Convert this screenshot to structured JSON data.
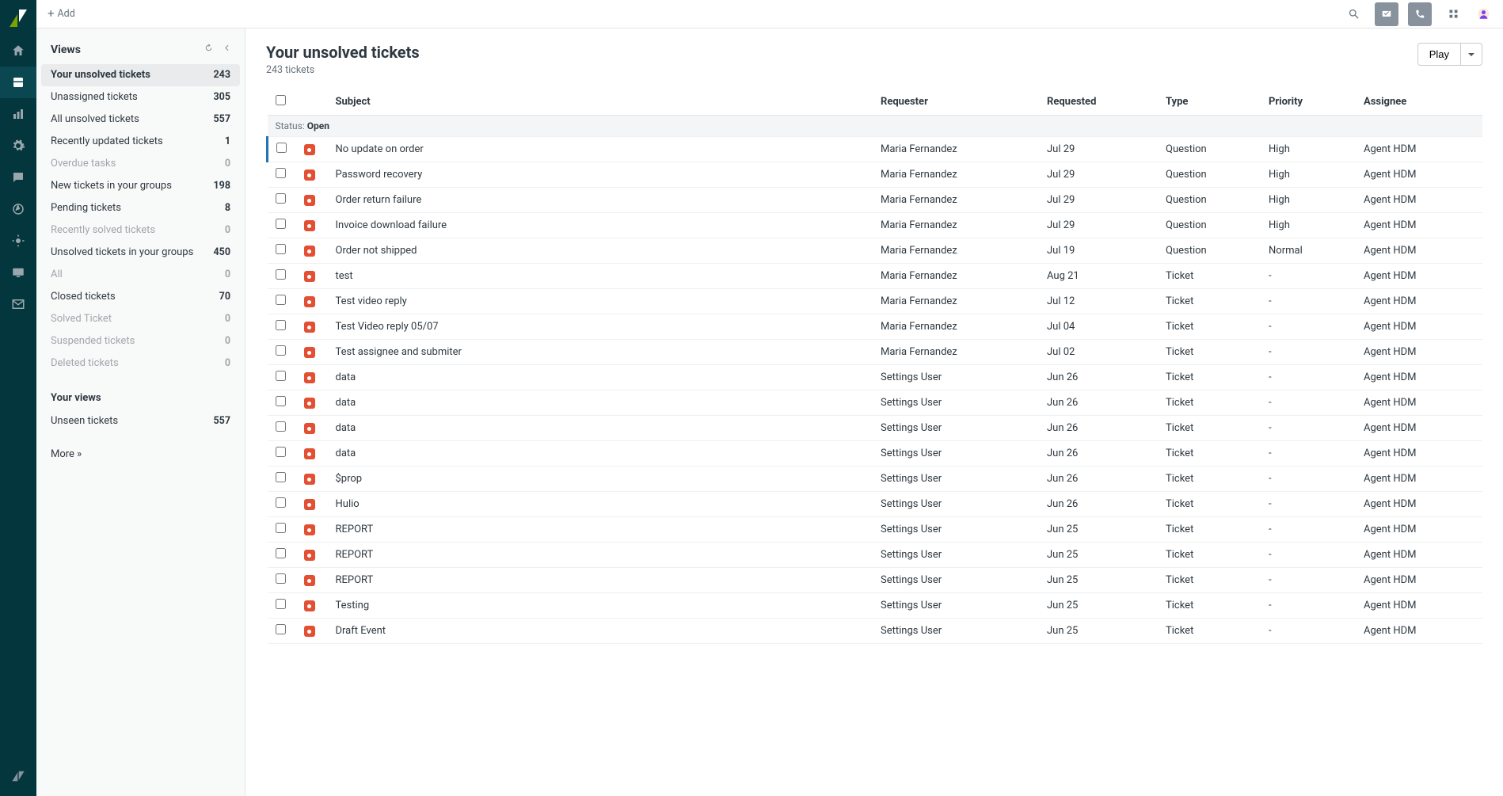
{
  "add_label": "Add",
  "rail": [
    {
      "name": "home-icon"
    },
    {
      "name": "views-icon",
      "active": true
    },
    {
      "name": "reporting-icon"
    },
    {
      "name": "admin-icon"
    },
    {
      "name": "chat-icon"
    },
    {
      "name": "explore-icon"
    },
    {
      "name": "sun-icon"
    },
    {
      "name": "desktop-icon"
    },
    {
      "name": "mail-icon"
    }
  ],
  "sidebar": {
    "heading": "Views",
    "section2": "Your views",
    "items": [
      {
        "label": "Your unsolved tickets",
        "count": "243",
        "active": true
      },
      {
        "label": "Unassigned tickets",
        "count": "305"
      },
      {
        "label": "All unsolved tickets",
        "count": "557"
      },
      {
        "label": "Recently updated tickets",
        "count": "1"
      },
      {
        "label": "Overdue tasks",
        "count": "0",
        "muted": true
      },
      {
        "label": "New tickets in your groups",
        "count": "198"
      },
      {
        "label": "Pending tickets",
        "count": "8"
      },
      {
        "label": "Recently solved tickets",
        "count": "0",
        "muted": true
      },
      {
        "label": "Unsolved tickets in your groups",
        "count": "450"
      },
      {
        "label": "All",
        "count": "0",
        "muted": true
      },
      {
        "label": "Closed tickets",
        "count": "70"
      },
      {
        "label": "Solved Ticket",
        "count": "0",
        "muted": true
      },
      {
        "label": "Suspended tickets",
        "count": "0",
        "muted": true
      },
      {
        "label": "Deleted tickets",
        "count": "0",
        "muted": true
      }
    ],
    "your_views": [
      {
        "label": "Unseen tickets",
        "count": "557"
      }
    ],
    "more": "More »"
  },
  "panel": {
    "title": "Your unsolved tickets",
    "subtitle": "243 tickets",
    "play": "Play",
    "status_label": "Status:",
    "status_value": "Open",
    "columns": [
      "Subject",
      "Requester",
      "Requested",
      "Type",
      "Priority",
      "Assignee"
    ]
  },
  "tickets": [
    {
      "subject": "No update on order",
      "requester": "Maria Fernandez",
      "requested": "Jul 29",
      "type": "Question",
      "priority": "High",
      "assignee": "Agent HDM",
      "selected": true
    },
    {
      "subject": "Password recovery",
      "requester": "Maria Fernandez",
      "requested": "Jul 29",
      "type": "Question",
      "priority": "High",
      "assignee": "Agent HDM"
    },
    {
      "subject": "Order return failure",
      "requester": "Maria Fernandez",
      "requested": "Jul 29",
      "type": "Question",
      "priority": "High",
      "assignee": "Agent HDM"
    },
    {
      "subject": "Invoice download failure",
      "requester": "Maria Fernandez",
      "requested": "Jul 29",
      "type": "Question",
      "priority": "High",
      "assignee": "Agent HDM"
    },
    {
      "subject": "Order not shipped",
      "requester": "Maria Fernandez",
      "requested": "Jul 19",
      "type": "Question",
      "priority": "Normal",
      "assignee": "Agent HDM"
    },
    {
      "subject": "test",
      "requester": "Maria Fernandez",
      "requested": "Aug 21",
      "type": "Ticket",
      "priority": "-",
      "assignee": "Agent HDM"
    },
    {
      "subject": "Test video reply",
      "requester": "Maria Fernandez",
      "requested": "Jul 12",
      "type": "Ticket",
      "priority": "-",
      "assignee": "Agent HDM"
    },
    {
      "subject": "Test Video reply 05/07",
      "requester": "Maria Fernandez",
      "requested": "Jul 04",
      "type": "Ticket",
      "priority": "-",
      "assignee": "Agent HDM"
    },
    {
      "subject": "Test assignee and submiter",
      "requester": "Maria Fernandez",
      "requested": "Jul 02",
      "type": "Ticket",
      "priority": "-",
      "assignee": "Agent HDM"
    },
    {
      "subject": "data",
      "requester": "Settings User",
      "requested": "Jun 26",
      "type": "Ticket",
      "priority": "-",
      "assignee": "Agent HDM"
    },
    {
      "subject": "data",
      "requester": "Settings User",
      "requested": "Jun 26",
      "type": "Ticket",
      "priority": "-",
      "assignee": "Agent HDM"
    },
    {
      "subject": "data",
      "requester": "Settings User",
      "requested": "Jun 26",
      "type": "Ticket",
      "priority": "-",
      "assignee": "Agent HDM"
    },
    {
      "subject": "data",
      "requester": "Settings User",
      "requested": "Jun 26",
      "type": "Ticket",
      "priority": "-",
      "assignee": "Agent HDM"
    },
    {
      "subject": "$prop",
      "requester": "Settings User",
      "requested": "Jun 26",
      "type": "Ticket",
      "priority": "-",
      "assignee": "Agent HDM"
    },
    {
      "subject": "Hulio",
      "requester": "Settings User",
      "requested": "Jun 26",
      "type": "Ticket",
      "priority": "-",
      "assignee": "Agent HDM"
    },
    {
      "subject": "REPORT",
      "requester": "Settings User",
      "requested": "Jun 25",
      "type": "Ticket",
      "priority": "-",
      "assignee": "Agent HDM"
    },
    {
      "subject": "REPORT",
      "requester": "Settings User",
      "requested": "Jun 25",
      "type": "Ticket",
      "priority": "-",
      "assignee": "Agent HDM"
    },
    {
      "subject": "REPORT",
      "requester": "Settings User",
      "requested": "Jun 25",
      "type": "Ticket",
      "priority": "-",
      "assignee": "Agent HDM"
    },
    {
      "subject": "Testing",
      "requester": "Settings User",
      "requested": "Jun 25",
      "type": "Ticket",
      "priority": "-",
      "assignee": "Agent HDM"
    },
    {
      "subject": "Draft Event",
      "requester": "Settings User",
      "requested": "Jun 25",
      "type": "Ticket",
      "priority": "-",
      "assignee": "Agent HDM"
    }
  ]
}
